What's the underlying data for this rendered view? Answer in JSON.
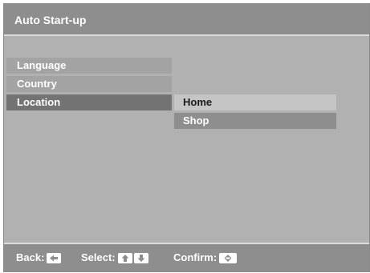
{
  "title": "Auto Start-up",
  "menu": {
    "items": [
      {
        "label": "Language"
      },
      {
        "label": "Country"
      },
      {
        "label": "Location"
      }
    ]
  },
  "location_options": {
    "items": [
      {
        "label": "Home"
      },
      {
        "label": "Shop"
      }
    ]
  },
  "footer": {
    "back_label": "Back:",
    "select_label": "Select:",
    "confirm_label": "Confirm:"
  },
  "icons": {
    "back": "left-arrow-icon",
    "up": "up-arrow-icon",
    "down": "down-arrow-icon",
    "confirm": "enter-icon"
  },
  "colors": {
    "background": "#b1b1b1",
    "bar": "#8e8e8e",
    "active_item": "#737373",
    "selected_option": "#c5c5c5"
  }
}
